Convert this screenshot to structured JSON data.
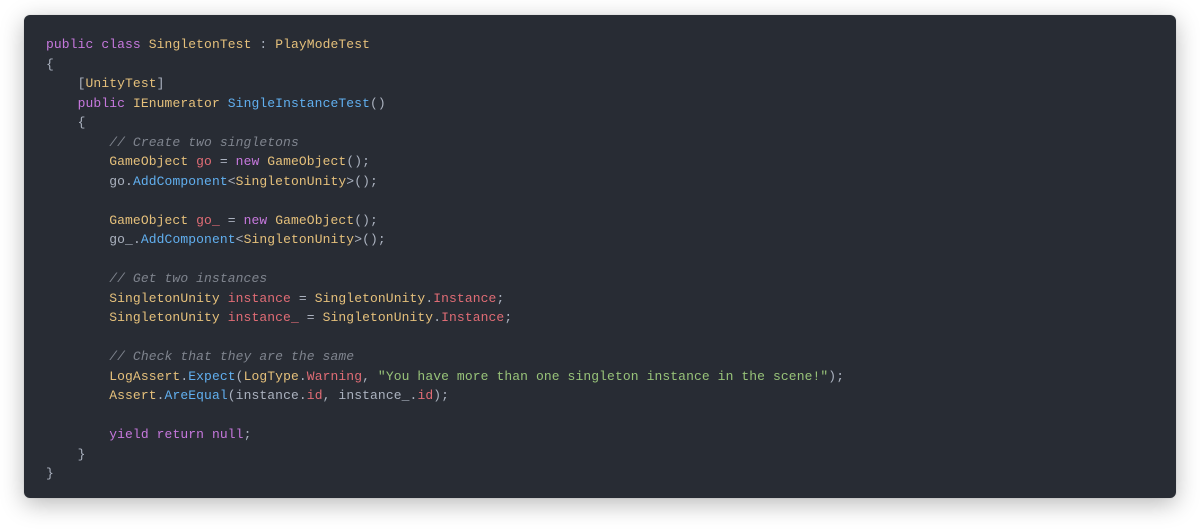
{
  "code": {
    "line1": {
      "kw_public": "public",
      "kw_class": "class",
      "cls_name": "SingletonTest",
      "colon": " : ",
      "base_name": "PlayModeTest"
    },
    "brace_open": "{",
    "attr": {
      "open": "[",
      "name": "UnityTest",
      "close": "]"
    },
    "line_sig": {
      "kw_public": "public",
      "ret_type": "IEnumerator",
      "method": "SingleInstanceTest",
      "parens": "()"
    },
    "brace_open2": "{",
    "cmt1": "// Create two singletons",
    "l_go_decl": {
      "type": "GameObject",
      "name": "go",
      "eq": " = ",
      "newkw": "new",
      "ctor": "GameObject",
      "parensemi": "();"
    },
    "l_go_add": {
      "obj": "go",
      "dot": ".",
      "method": "AddComponent",
      "lt": "<",
      "gtype": "SingletonUnity",
      "gt": ">",
      "parensemi": "();"
    },
    "l_go2_decl": {
      "type": "GameObject",
      "name": "go_",
      "eq": " = ",
      "newkw": "new",
      "ctor": "GameObject",
      "parensemi": "();"
    },
    "l_go2_add": {
      "obj": "go_",
      "dot": ".",
      "method": "AddComponent",
      "lt": "<",
      "gtype": "SingletonUnity",
      "gt": ">",
      "parensemi": "();"
    },
    "cmt2": "// Get two instances",
    "l_inst1": {
      "type": "SingletonUnity",
      "name": "instance",
      "eq": " = ",
      "cls": "SingletonUnity",
      "dot": ".",
      "prop": "Instance",
      "semi": ";"
    },
    "l_inst2": {
      "type": "SingletonUnity",
      "name": "instance_",
      "eq": " = ",
      "cls": "SingletonUnity",
      "dot": ".",
      "prop": "Instance",
      "semi": ";"
    },
    "cmt3": "// Check that they are the same",
    "l_log": {
      "cls": "LogAssert",
      "dot": ".",
      "method": "Expect",
      "open": "(",
      "arg_cls": "LogType",
      "arg_dot": ".",
      "arg_prop": "Warning",
      "comma": ", ",
      "str": "\"You have more than one singleton instance in the scene!\"",
      "close": ");"
    },
    "l_assert": {
      "cls": "Assert",
      "dot": ".",
      "method": "AreEqual",
      "open": "(",
      "a1": "instance",
      "d1": ".",
      "p1": "id",
      "comma": ", ",
      "a2": "instance_",
      "d2": ".",
      "p2": "id",
      "close": ");"
    },
    "l_yield": {
      "kw_yield": "yield",
      "kw_return": "return",
      "kw_null": "null",
      "semi": ";"
    },
    "brace_close2": "}",
    "brace_close": "}"
  }
}
